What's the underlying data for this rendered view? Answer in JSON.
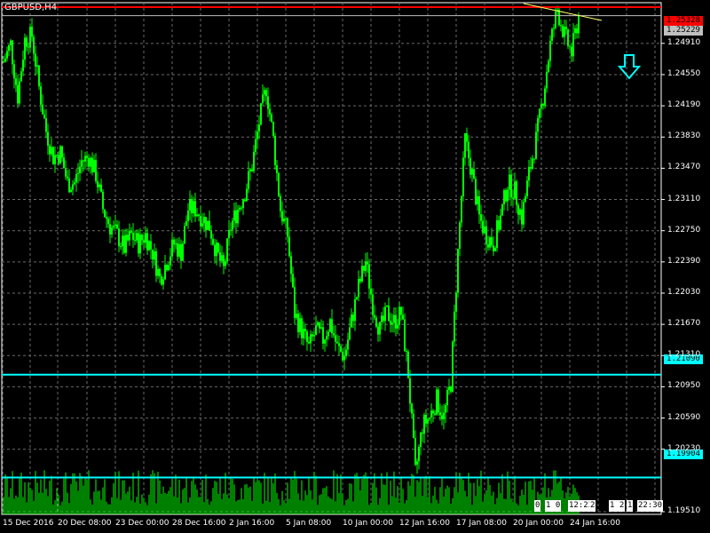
{
  "header": {
    "symbol": "GBPUSD,H4"
  },
  "colors": {
    "background": "#000000",
    "grid": "#6a6a6a",
    "candles": "#00ff00",
    "volumes": "#00ff00",
    "current_price_line": "#ff0000",
    "level_line": "#00ffff",
    "trend_line": "#ffff66",
    "arrow": "#00ffff"
  },
  "price_tags": {
    "current": "1.25328",
    "bid": "1.25229",
    "level_high": "1.21090",
    "level_low": "1.19904"
  },
  "timer": {
    "segments": [
      "0",
      "1 0",
      "12:23",
      "2",
      "1 2",
      "1",
      "22:30"
    ]
  },
  "chart_data": {
    "type": "candlestick",
    "title": "GBPUSD,H4",
    "y_ticks": [
      "1.24910",
      "1.24550",
      "1.24190",
      "1.23830",
      "1.23470",
      "1.23110",
      "1.22750",
      "1.22390",
      "1.22030",
      "1.21670",
      "1.21310",
      "1.20950",
      "1.20590",
      "1.20230",
      "1.19510"
    ],
    "ylim": [
      1.1951,
      1.2541
    ],
    "x_ticks": [
      "15 Dec 2016",
      "20 Dec 08:00",
      "23 Dec 00:00",
      "28 Dec 16:00",
      "2 Jan 16:00",
      "5 Jan 08:00",
      "10 Jan 00:00",
      "12 Jan 16:00",
      "17 Jan 08:00",
      "20 Jan 00:00",
      "24 Jan 16:00"
    ],
    "lines": {
      "current_price": 1.25328,
      "bid_price": 1.25229,
      "horizontal_levels": [
        1.2109,
        1.19904
      ]
    },
    "arrow_signal": "down",
    "volumes": "volume histogram at bottom of chart",
    "approx_close_path": [
      [
        0,
        1.247
      ],
      [
        4,
        1.249
      ],
      [
        8,
        1.243
      ],
      [
        12,
        1.2495
      ],
      [
        16,
        1.25
      ],
      [
        20,
        1.244
      ],
      [
        24,
        1.239
      ],
      [
        28,
        1.236
      ],
      [
        32,
        1.2365
      ],
      [
        36,
        1.233
      ],
      [
        40,
        1.233
      ],
      [
        44,
        1.2355
      ],
      [
        48,
        1.236
      ],
      [
        52,
        1.234
      ],
      [
        56,
        1.23
      ],
      [
        60,
        1.228
      ],
      [
        64,
        1.227
      ],
      [
        68,
        1.2255
      ],
      [
        72,
        1.227
      ],
      [
        76,
        1.226
      ],
      [
        80,
        1.227
      ],
      [
        84,
        1.225
      ],
      [
        88,
        1.222
      ],
      [
        92,
        1.224
      ],
      [
        96,
        1.226
      ],
      [
        100,
        1.225
      ],
      [
        104,
        1.23
      ],
      [
        108,
        1.23
      ],
      [
        112,
        1.229
      ],
      [
        116,
        1.228
      ],
      [
        120,
        1.225
      ],
      [
        124,
        1.223
      ],
      [
        128,
        1.228
      ],
      [
        132,
        1.23
      ],
      [
        136,
        1.232
      ],
      [
        140,
        1.235
      ],
      [
        144,
        1.24
      ],
      [
        148,
        1.244
      ],
      [
        152,
        1.238
      ],
      [
        156,
        1.23
      ],
      [
        160,
        1.227
      ],
      [
        164,
        1.218
      ],
      [
        168,
        1.216
      ],
      [
        172,
        1.214
      ],
      [
        176,
        1.216
      ],
      [
        180,
        1.215
      ],
      [
        184,
        1.217
      ],
      [
        188,
        1.214
      ],
      [
        192,
        1.213
      ],
      [
        196,
        1.217
      ],
      [
        200,
        1.221
      ],
      [
        204,
        1.224
      ],
      [
        208,
        1.219
      ],
      [
        212,
        1.216
      ],
      [
        216,
        1.218
      ],
      [
        220,
        1.217
      ],
      [
        224,
        1.218
      ],
      [
        228,
        1.211
      ],
      [
        232,
        1.1995
      ],
      [
        236,
        1.205
      ],
      [
        240,
        1.206
      ],
      [
        244,
        1.208
      ],
      [
        248,
        1.206
      ],
      [
        252,
        1.21
      ],
      [
        256,
        1.225
      ],
      [
        260,
        1.238
      ],
      [
        264,
        1.234
      ],
      [
        268,
        1.229
      ],
      [
        272,
        1.227
      ],
      [
        276,
        1.226
      ],
      [
        280,
        1.229
      ],
      [
        284,
        1.233
      ],
      [
        288,
        1.232
      ],
      [
        292,
        1.229
      ],
      [
        296,
        1.234
      ],
      [
        300,
        1.238
      ],
      [
        304,
        1.243
      ],
      [
        308,
        1.249
      ],
      [
        312,
        1.253
      ],
      [
        316,
        1.25
      ],
      [
        320,
        1.248
      ],
      [
        324,
        1.2523
      ]
    ]
  }
}
